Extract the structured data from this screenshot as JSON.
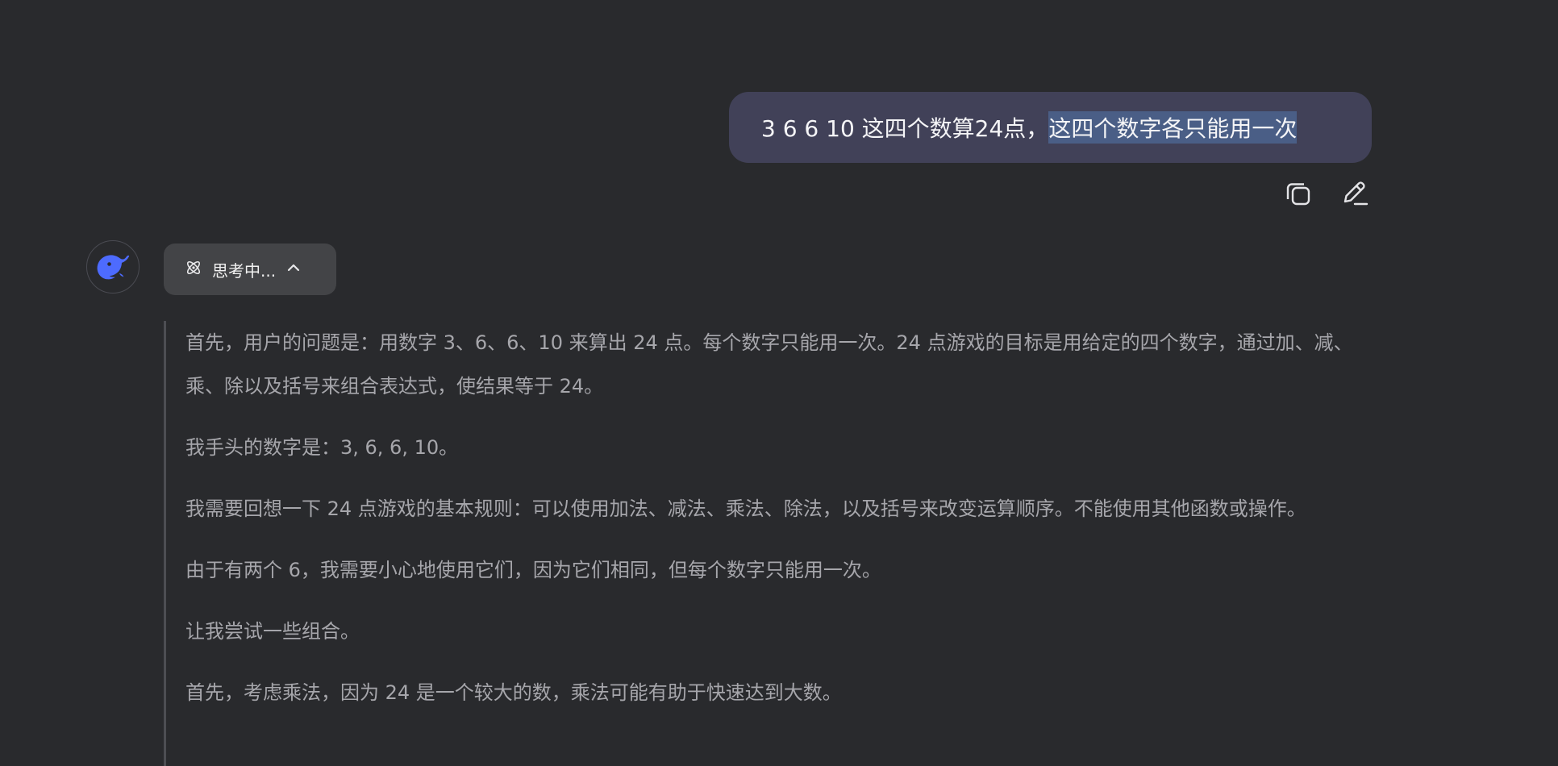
{
  "user_message": {
    "text_plain": "3 6 6 10 这四个数算24点，",
    "text_selected": "这四个数字各只能用一次"
  },
  "message_actions": {
    "copy_icon": "copy-icon",
    "edit_icon": "edit-icon"
  },
  "assistant": {
    "avatar_icon": "deepseek-whale-icon",
    "thinking_label": "思考中...",
    "thinking_icon": "atom-icon",
    "toggle_icon": "chevron-up-icon",
    "paragraphs": [
      "首先，用户的问题是：用数字 3、6、6、10 来算出 24 点。每个数字只能用一次。24 点游戏的目标是用给定的四个数字，通过加、减、乘、除以及括号来组合表达式，使结果等于 24。",
      "我手头的数字是：3, 6, 6, 10。",
      "我需要回想一下 24 点游戏的基本规则：可以使用加法、减法、乘法、除法，以及括号来改变运算顺序。不能使用其他函数或操作。",
      "由于有两个 6，我需要小心地使用它们，因为它们相同，但每个数字只能用一次。",
      "让我尝试一些组合。",
      "首先，考虑乘法，因为 24 是一个较大的数，乘法可能有助于快速达到大数。"
    ]
  },
  "colors": {
    "background": "#292a2d",
    "user_bubble": "#414158",
    "selection": "#4a5e86",
    "accent": "#4d6bfe",
    "thought_text": "#a6a6ab"
  }
}
